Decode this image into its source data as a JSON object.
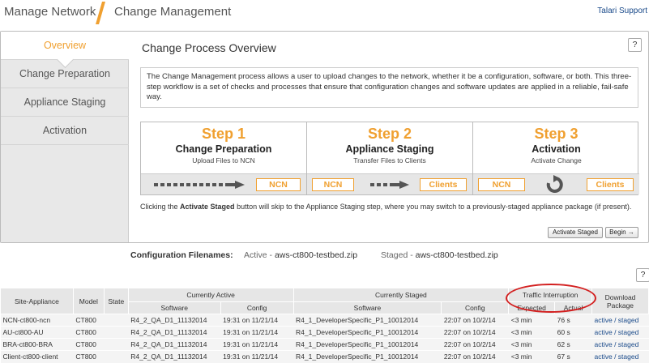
{
  "header": {
    "crumb1": "Manage Network",
    "crumb2": "Change Management",
    "support": "Talari Support"
  },
  "sidebar": {
    "items": [
      {
        "label": "Overview"
      },
      {
        "label": "Change Preparation"
      },
      {
        "label": "Appliance Staging"
      },
      {
        "label": "Activation"
      }
    ]
  },
  "main": {
    "title": "Change Process Overview",
    "help": "?",
    "description": "The Change Management process allows a user to upload changes to the network, whether it be a configuration, software, or both. This three-step workflow is a set of checks and processes that ensure that configuration changes and software updates are applied in a reliable, fail-safe way.",
    "steps": [
      {
        "num": "Step 1",
        "name": "Change Preparation",
        "sub": "Upload Files to NCN",
        "tags": [
          "NCN"
        ]
      },
      {
        "num": "Step 2",
        "name": "Appliance Staging",
        "sub": "Transfer Files to Clients",
        "tags": [
          "NCN",
          "Clients"
        ]
      },
      {
        "num": "Step 3",
        "name": "Activation",
        "sub": "Activate Change",
        "tags": [
          "NCN",
          "Clients"
        ]
      }
    ],
    "note_pre": "Clicking the ",
    "note_bold": "Activate Staged",
    "note_post": " button will skip to the Appliance Staging step, where you may switch to a previously-staged appliance package (if present).",
    "activate_btn": "Activate Staged",
    "begin_btn": "Begin →"
  },
  "config": {
    "label": "Configuration Filenames:",
    "active_label": "Active - ",
    "active_value": "aws-ct800-testbed.zip",
    "staged_label": "Staged - ",
    "staged_value": "aws-ct800-testbed.zip",
    "help": "?"
  },
  "table": {
    "headers": {
      "site": "Site-Appliance",
      "model": "Model",
      "state": "State",
      "currently_active": "Currently Active",
      "currently_staged": "Currently Staged",
      "traffic": "Traffic Interruption",
      "download": "Download Package",
      "software": "Software",
      "config": "Config",
      "expected": "Expected",
      "actual": "Actual"
    },
    "rows": [
      {
        "site": "NCN-ct800-ncn",
        "model": "CT800",
        "state": "",
        "a_sw": "R4_2_QA_D1_11132014",
        "a_cfg": "19:31 on 11/21/14",
        "s_sw": "R4_1_DeveloperSpecific_P1_10012014",
        "s_cfg": "22:07 on 10/2/14",
        "exp": "<3 min",
        "act": "76 s",
        "dl": "active / staged"
      },
      {
        "site": "AU-ct800-AU",
        "model": "CT800",
        "state": "",
        "a_sw": "R4_2_QA_D1_11132014",
        "a_cfg": "19:31 on 11/21/14",
        "s_sw": "R4_1_DeveloperSpecific_P1_10012014",
        "s_cfg": "22:07 on 10/2/14",
        "exp": "<3 min",
        "act": "60 s",
        "dl": "active / staged"
      },
      {
        "site": "BRA-ct800-BRA",
        "model": "CT800",
        "state": "",
        "a_sw": "R4_2_QA_D1_11132014",
        "a_cfg": "19:31 on 11/21/14",
        "s_sw": "R4_1_DeveloperSpecific_P1_10012014",
        "s_cfg": "22:07 on 10/2/14",
        "exp": "<3 min",
        "act": "62 s",
        "dl": "active / staged"
      },
      {
        "site": "Client-ct800-client",
        "model": "CT800",
        "state": "",
        "a_sw": "R4_2_QA_D1_11132014",
        "a_cfg": "19:31 on 11/21/14",
        "s_sw": "R4_1_DeveloperSpecific_P1_10012014",
        "s_cfg": "22:07 on 10/2/14",
        "exp": "<3 min",
        "act": "67 s",
        "dl": "active / staged"
      }
    ]
  },
  "colors": {
    "accent": "#f0a030",
    "link": "#1a4a8a",
    "highlight": "#d32020"
  }
}
